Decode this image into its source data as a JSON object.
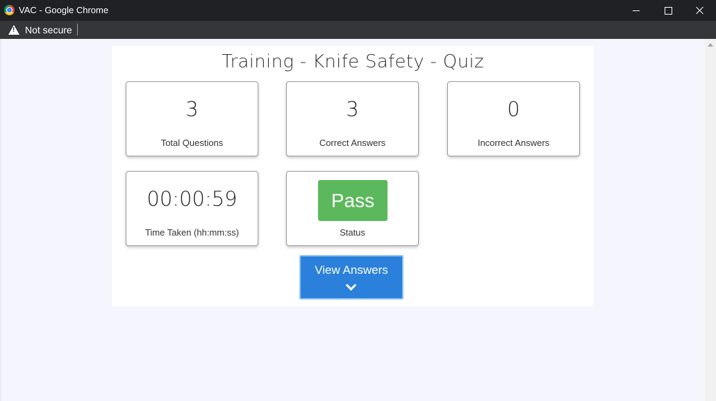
{
  "window": {
    "title": "VAC - Google Chrome"
  },
  "addressbar": {
    "security_label": "Not secure"
  },
  "quiz": {
    "title": "Training - Knife Safety - Quiz",
    "total_questions": {
      "value": "3",
      "label": "Total Questions"
    },
    "correct_answers": {
      "value": "3",
      "label": "Correct Answers"
    },
    "incorrect_answers": {
      "value": "0",
      "label": "Incorrect Answers"
    },
    "time_taken": {
      "value": "00:00:59",
      "label": "Time Taken (hh:mm:ss)"
    },
    "status": {
      "value": "Pass",
      "label": "Status",
      "color": "#5cb85c"
    }
  },
  "view_answers": {
    "label": "View Answers",
    "icon": "chevron-down-icon",
    "color": "#2a80db"
  },
  "icons": [
    "chrome-icon",
    "warning-icon",
    "minimize-icon",
    "maximize-icon",
    "close-icon",
    "chevron-down-icon"
  ]
}
